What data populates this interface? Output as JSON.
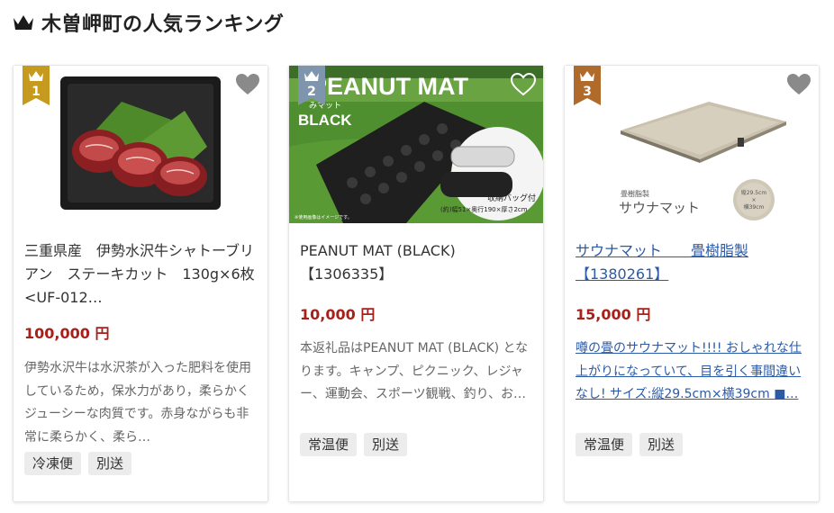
{
  "header": {
    "title": "木曽岬町の人気ランキング",
    "icon": "crown-icon"
  },
  "colors": {
    "gold": "#c59a1f",
    "silver": "#7f95ad",
    "bronze": "#b06a2a",
    "price": "#a8201a",
    "link": "#2b5aa7"
  },
  "items": [
    {
      "rank": "1",
      "name": "三重県産　伊勢水沢牛シャトーブリアン　ステーキカット　130g×6枚<UF-012…",
      "price": "100,000 円",
      "description": "伊勢水沢牛は水沢茶が入った肥料を使用しているため，保水力があり，柔らかくジューシーな肉質です。赤身ながらも非常に柔らかく、柔ら…",
      "tags": [
        "冷凍便",
        "別送"
      ]
    },
    {
      "rank": "2",
      "name": "PEANUT MAT (BLACK)【1306335】",
      "price": "10,000 円",
      "description": "本返礼品はPEANUT MAT (BLACK) となります。キャンプ、ピクニック、レジャー、運動会、スポーツ観戦、釣り、お…",
      "tags": [
        "常温便",
        "別送"
      ],
      "image_text": {
        "brand": "PEANUT MAT",
        "sub": "BLACK",
        "small": "みマット",
        "bag": "収納バッグ付",
        "size": "(約)幅51×奥行190×厚さ2cm",
        "note": "※使用画像はイメージです。"
      }
    },
    {
      "rank": "3",
      "name": "サウナマット　　畳樹脂製【1380261】",
      "price": "15,000 円",
      "description": "噂の畳のサウナマット!!!! おしゃれな仕上がりになっていて、目を引く事間違いなし! サイズ:縦29.5cm×横39cm ■…",
      "tags": [
        "常温便",
        "別送"
      ],
      "image_text": {
        "label1": "畳樹脂製",
        "label2": "サウナマット",
        "size_top": "縦29.5cm",
        "size_mid": "×",
        "size_bot": "横39cm"
      }
    }
  ]
}
